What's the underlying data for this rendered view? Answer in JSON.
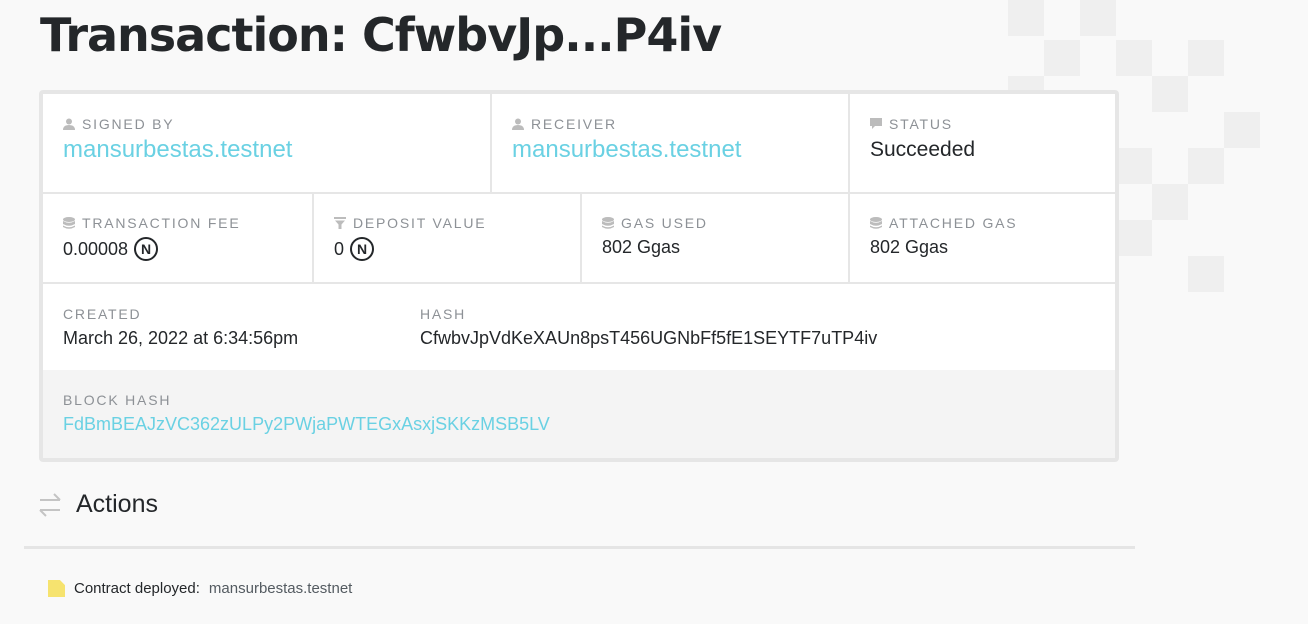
{
  "page": {
    "title": "Transaction: CfwbvJp...P4iv"
  },
  "details": {
    "signed_by": {
      "label": "SIGNED BY",
      "value": "mansurbestas.testnet"
    },
    "receiver": {
      "label": "RECEIVER",
      "value": "mansurbestas.testnet"
    },
    "status": {
      "label": "STATUS",
      "value": "Succeeded"
    },
    "transaction_fee": {
      "label": "TRANSACTION FEE",
      "value": "0.00008",
      "unit_symbol": "N"
    },
    "deposit_value": {
      "label": "DEPOSIT VALUE",
      "value": "0",
      "unit_symbol": "N"
    },
    "gas_used": {
      "label": "GAS USED",
      "value": "802 Ggas"
    },
    "attached_gas": {
      "label": "ATTACHED GAS",
      "value": "802 Ggas"
    },
    "created": {
      "label": "CREATED",
      "value": "March 26, 2022 at 6:34:56pm"
    },
    "hash": {
      "label": "HASH",
      "value": "CfwbvJpVdKeXAUn8psT456UGNbFf5fE1SEYTF7uTP4iv"
    },
    "block_hash": {
      "label": "BLOCK HASH",
      "value": "FdBmBEAJzVC362zULPy2PWjaPWTEGxAsxjSKKzMSB5LV"
    }
  },
  "actions": {
    "title": "Actions",
    "items": [
      {
        "text": "Contract deployed:",
        "account": "mansurbestas.testnet",
        "icon": "contract-icon"
      }
    ]
  },
  "colors": {
    "link": "#6ad1e3",
    "text": "#24272a",
    "label": "#8d9196",
    "action_icon": "#f6e36f"
  }
}
